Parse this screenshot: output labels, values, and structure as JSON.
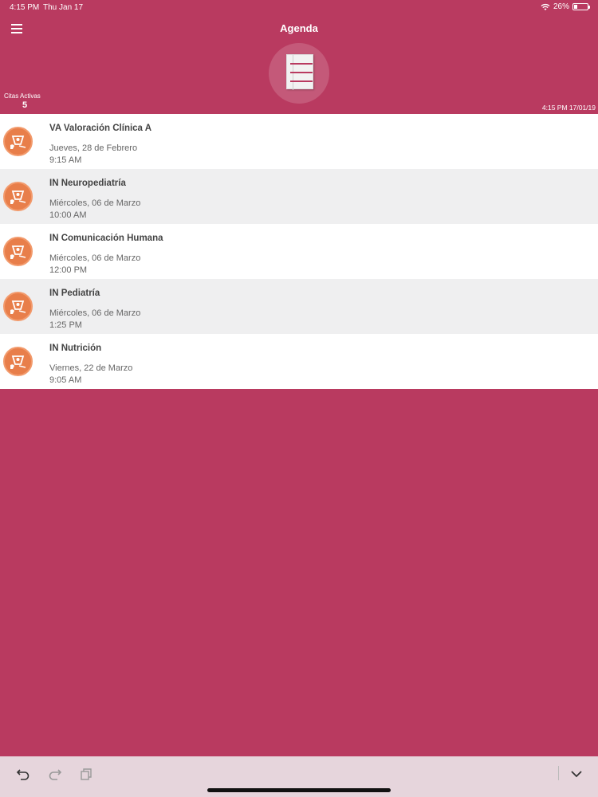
{
  "status_bar": {
    "time": "4:15 PM",
    "date": "Thu Jan 17",
    "battery": "26%",
    "battery_level": 0.26
  },
  "header": {
    "title": "Agenda",
    "citas_label": "Citas Activas",
    "citas_count": "5",
    "datetime": "4:15 PM 17/01/19"
  },
  "appointments": [
    {
      "title": "VA Valoración Clínica A",
      "date": "Jueves, 28 de Febrero",
      "time": "9:15 AM"
    },
    {
      "title": "IN Neuropediatría",
      "date": "Miércoles, 06 de Marzo",
      "time": "10:00 AM"
    },
    {
      "title": "IN Comunicación Humana",
      "date": "Miércoles, 06 de Marzo",
      "time": "12:00 PM"
    },
    {
      "title": "IN Pediatría",
      "date": "Miércoles, 06 de Marzo",
      "time": "1:25 PM"
    },
    {
      "title": "IN Nutrición",
      "date": "Viernes, 22 de Marzo",
      "time": "9:05 AM"
    }
  ],
  "colors": {
    "brand": "#b93a60",
    "avatar": "#e87e4a",
    "row_alt": "#efeff0",
    "toolbar": "#e6d5dc"
  },
  "icons": {
    "menu": "hamburger-menu-icon",
    "document": "document-icon",
    "avatar": "therapy-icon",
    "undo": "undo-icon",
    "redo": "redo-icon",
    "copy": "copy-icon",
    "collapse": "chevron-down-icon"
  }
}
